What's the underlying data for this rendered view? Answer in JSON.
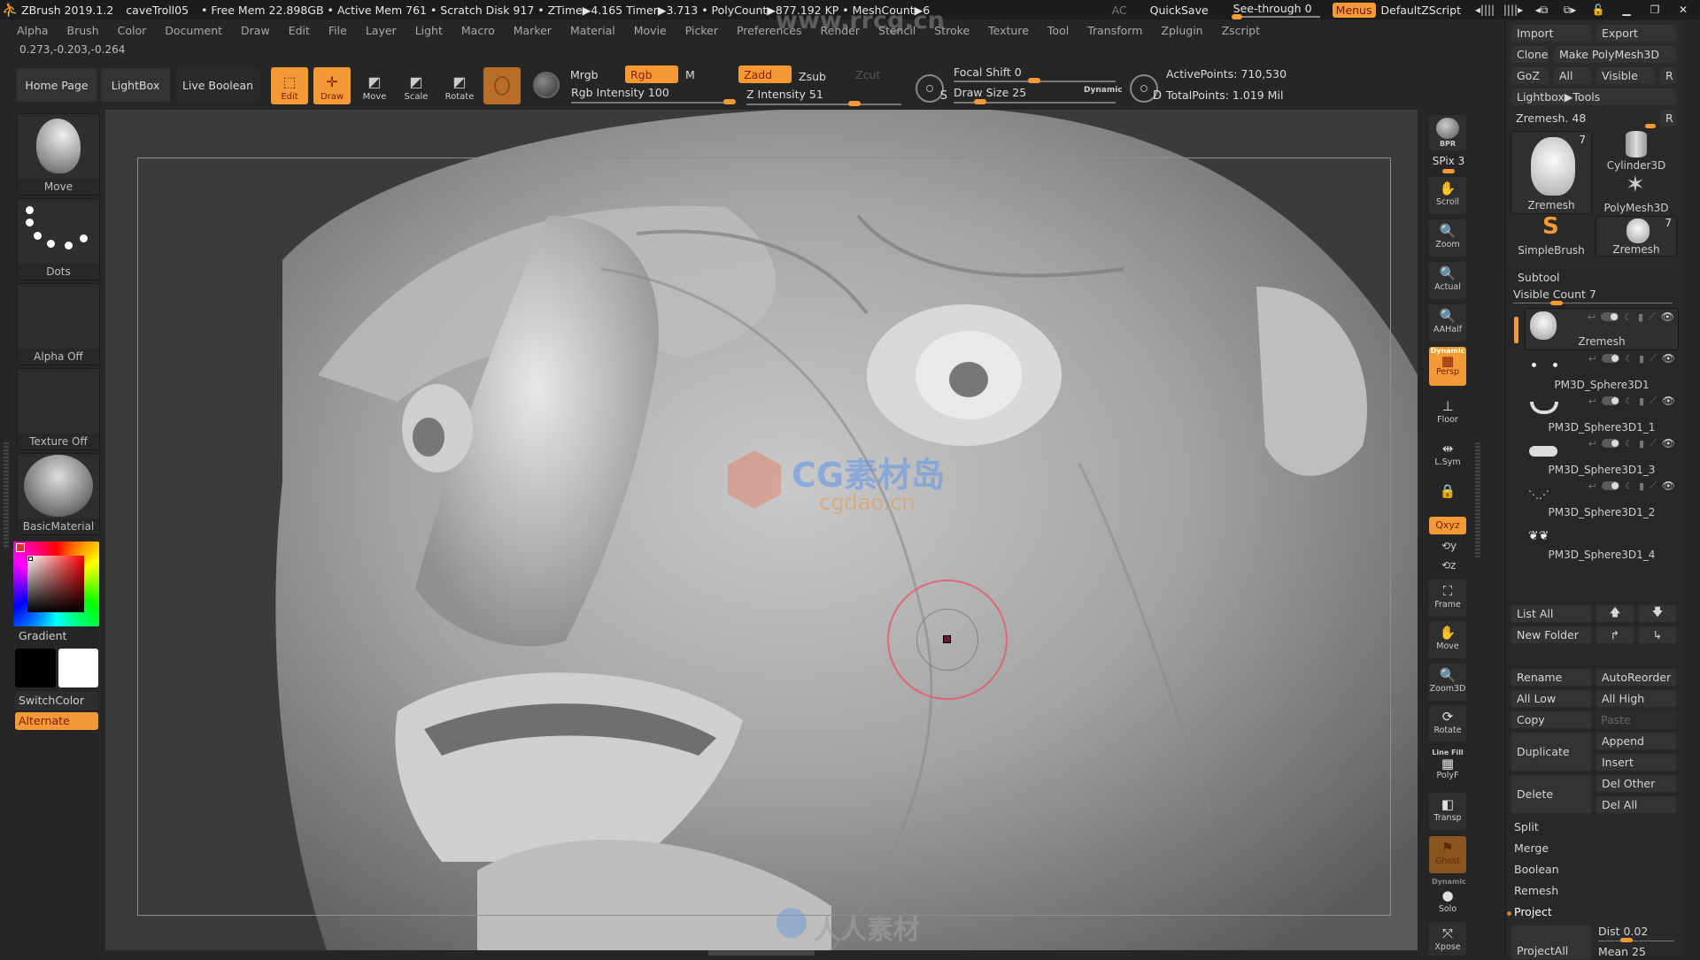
{
  "titlebar": {
    "app": "ZBrush 2019.1.2",
    "document": "caveTroll05",
    "stats": "• Free Mem 22.898GB • Active Mem 761 • Scratch Disk 917 • ZTime▶4.165 Timer▶3.713 • PolyCount▶877.192 KP • MeshCount▶6",
    "ac": "AC",
    "quicksave": "QuickSave",
    "see_through": "See-through  0",
    "see_through_value": 0,
    "menus": "Menus",
    "script": "DefaultZScript"
  },
  "menubar": [
    "Alpha",
    "Brush",
    "Color",
    "Document",
    "Draw",
    "Edit",
    "File",
    "Layer",
    "Light",
    "Macro",
    "Marker",
    "Material",
    "Movie",
    "Picker",
    "Preferences",
    "Render",
    "Stencil",
    "Stroke",
    "Texture",
    "Tool",
    "Transform",
    "Zplugin",
    "Zscript"
  ],
  "coords": "0.273,-0.203,-0.264",
  "shelf": {
    "home_page": "Home Page",
    "lightbox": "LightBox",
    "live_boolean": "Live Boolean",
    "edit": "Edit",
    "draw": "Draw",
    "move": "Move",
    "scale": "Scale",
    "rotate": "Rotate",
    "mrgb": "Mrgb",
    "rgb": "Rgb",
    "m": "M",
    "zadd": "Zadd",
    "zsub": "Zsub",
    "zcut": "Zcut",
    "rgb_intensity_label": "Rgb Intensity 100",
    "rgb_intensity": 100,
    "z_intensity_label": "Z Intensity 51",
    "z_intensity": 51,
    "focal_shift_label": "Focal Shift 0",
    "focal_shift": 0,
    "draw_size_label": "Draw Size 25",
    "draw_size": 25,
    "dynamic": "Dynamic",
    "s_key": "S",
    "d_key": "D",
    "active_points": "ActivePoints: 710,530",
    "total_points": "TotalPoints: 1.019 Mil"
  },
  "left_panel": {
    "brush": "Move",
    "stroke": "Dots",
    "alpha": "Alpha Off",
    "texture": "Texture Off",
    "material": "BasicMaterial",
    "gradient": "Gradient",
    "switch_color": "SwitchColor",
    "alternate": "Alternate",
    "main_color": "#000000",
    "secondary_color": "#ffffff"
  },
  "right_toolbar": {
    "bpr": "BPR",
    "spix": "SPix 3",
    "scroll": "Scroll",
    "zoom": "Zoom",
    "actual": "Actual",
    "aahalf": "AAHalf",
    "dynamic": "Dynamic",
    "persp": "Persp",
    "floor": "Floor",
    "lsym": "L.Sym",
    "xyz": "Qxyz",
    "frame": "Frame",
    "move": "Move",
    "zoom3d": "Zoom3D",
    "rotate": "Rotate",
    "line_fill": "Line Fill",
    "polyf": "PolyF",
    "transp": "Transp",
    "ghost": "Ghost",
    "dynamic2": "Dynamic",
    "solo": "Solo",
    "xpose": "Xpose"
  },
  "tool_panel": {
    "import": "Import",
    "export": "Export",
    "clone": "Clone",
    "make_polymesh": "Make PolyMesh3D",
    "goz": "GoZ",
    "all": "All",
    "visible": "Visible",
    "r": "R",
    "lightbox_tools": "Lightbox▶Tools",
    "zremesh_label": "Zremesh. 48",
    "tools": [
      {
        "name": "Zremesh",
        "count": "7"
      },
      {
        "name": "Cylinder3D",
        "count": ""
      },
      {
        "name": "PolyMesh3D",
        "count": ""
      },
      {
        "name": "SimpleBrush",
        "count": ""
      },
      {
        "name": "Zremesh",
        "count": "7"
      }
    ]
  },
  "subtool": {
    "title": "Subtool",
    "visible_count": "Visible Count 7",
    "items": [
      {
        "name": "Zremesh"
      },
      {
        "name": "PM3D_Sphere3D1"
      },
      {
        "name": "PM3D_Sphere3D1_1"
      },
      {
        "name": "PM3D_Sphere3D1_3"
      },
      {
        "name": "PM3D_Sphere3D1_2"
      },
      {
        "name": "PM3D_Sphere3D1_4"
      }
    ],
    "list_all": "List All",
    "new_folder": "New Folder",
    "rename": "Rename",
    "auto_reorder": "AutoReorder",
    "all_low": "All Low",
    "all_high": "All High",
    "copy": "Copy",
    "paste": "Paste",
    "duplicate": "Duplicate",
    "append": "Append",
    "insert": "Insert",
    "delete": "Delete",
    "del_other": "Del Other",
    "del_all": "Del All",
    "split": "Split",
    "merge": "Merge",
    "boolean": "Boolean",
    "remesh": "Remesh",
    "project": "Project",
    "project_all": "ProjectAll",
    "dist": "Dist 0.02",
    "mean": "Mean 25"
  },
  "watermarks": {
    "top": "www.rrcg.cn",
    "center": "CG素材岛",
    "center_sub": "cgdao.cn",
    "bottom": "人人素材"
  },
  "colors": {
    "accent": "#f39a36",
    "accent_text": "#7a1c00",
    "bg": "#262626"
  }
}
